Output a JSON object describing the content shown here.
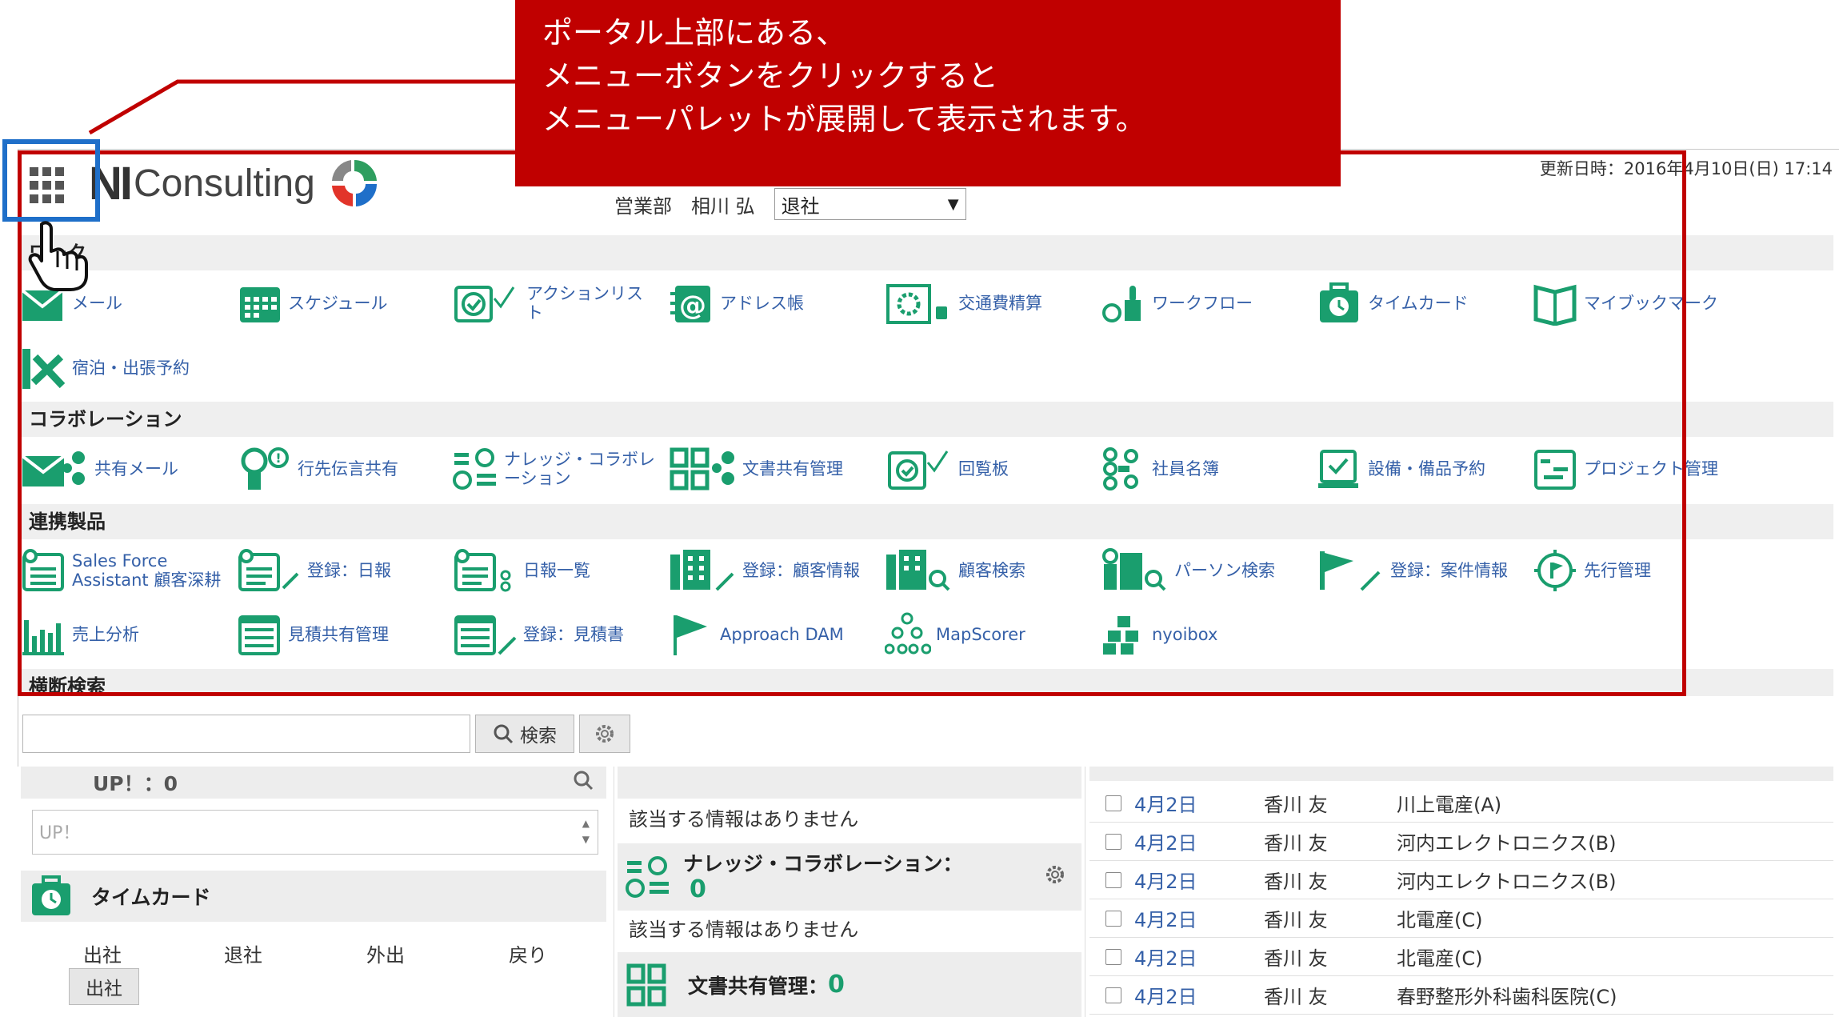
{
  "header": {
    "updated": "更新日時：2016年4月10日(日) 17:14",
    "logo_ni": "NI",
    "logo_text": "Consulting",
    "department": "営業部",
    "user_name": "相川 弘",
    "status_value": "退社"
  },
  "callout": {
    "line1": "ポータル上部にある、",
    "line2": "メニューボタンをクリックすると",
    "line3": "メニューパレットが展開して表示されます。"
  },
  "palette": {
    "sections": [
      "ワーク",
      "コラボレーション",
      "連携製品",
      "横断検索"
    ],
    "work": [
      "メール",
      "スケジュール",
      "アクションリスト",
      "アドレス帳",
      "交通費精算",
      "ワークフロー",
      "タイムカード",
      "マイブックマーク",
      "宿泊・出張予約"
    ],
    "collab": [
      "共有メール",
      "行先伝言共有",
      "ナレッジ・コラボレーション",
      "文書共有管理",
      "回覧板",
      "社員名簿",
      "設備・備品予約",
      "プロジェクト管理"
    ],
    "linked": [
      "Sales Force Assistant 顧客深耕",
      "登録：日報",
      "日報一覧",
      "登録：顧客情報",
      "顧客検索",
      "パーソン検索",
      "登録：案件情報",
      "先行管理",
      "売上分析",
      "見積共有管理",
      "登録：見積書",
      "Approach DAM",
      "MapScorer",
      "nyoibox"
    ]
  },
  "search": {
    "button_label": "検索",
    "placeholder": ""
  },
  "lower": {
    "up_title": "UP！：0",
    "up_placeholder": "UP！",
    "timecard_title": "タイムカード",
    "timecard_cols": [
      "出社",
      "退社",
      "外出",
      "戻り"
    ],
    "timecard_button": "出社",
    "no_info_1": "該当する情報はありません",
    "knowledge_title": "ナレッジ・コラボレーション：",
    "knowledge_count": "0",
    "no_info_2": "該当する情報はありません",
    "docs_title": "文書共有管理：",
    "docs_count": "0",
    "rows": [
      {
        "date": "4月2日",
        "name": "香川 友",
        "customer": "川上電産(A)"
      },
      {
        "date": "4月2日",
        "name": "香川 友",
        "customer": "河内エレクトロニクス(B)"
      },
      {
        "date": "4月2日",
        "name": "香川 友",
        "customer": "河内エレクトロニクス(B)"
      },
      {
        "date": "4月2日",
        "name": "香川 友",
        "customer": "北電産(C)"
      },
      {
        "date": "4月2日",
        "name": "香川 友",
        "customer": "北電産(C)"
      },
      {
        "date": "4月2日",
        "name": "香川 友",
        "customer": "春野整形外科歯科医院(C)"
      }
    ]
  },
  "colors": {
    "accent_green": "#1a9e6e",
    "link_blue": "#3560a8",
    "annotation_red": "#c00000",
    "annotation_blue": "#1f6fc9"
  }
}
